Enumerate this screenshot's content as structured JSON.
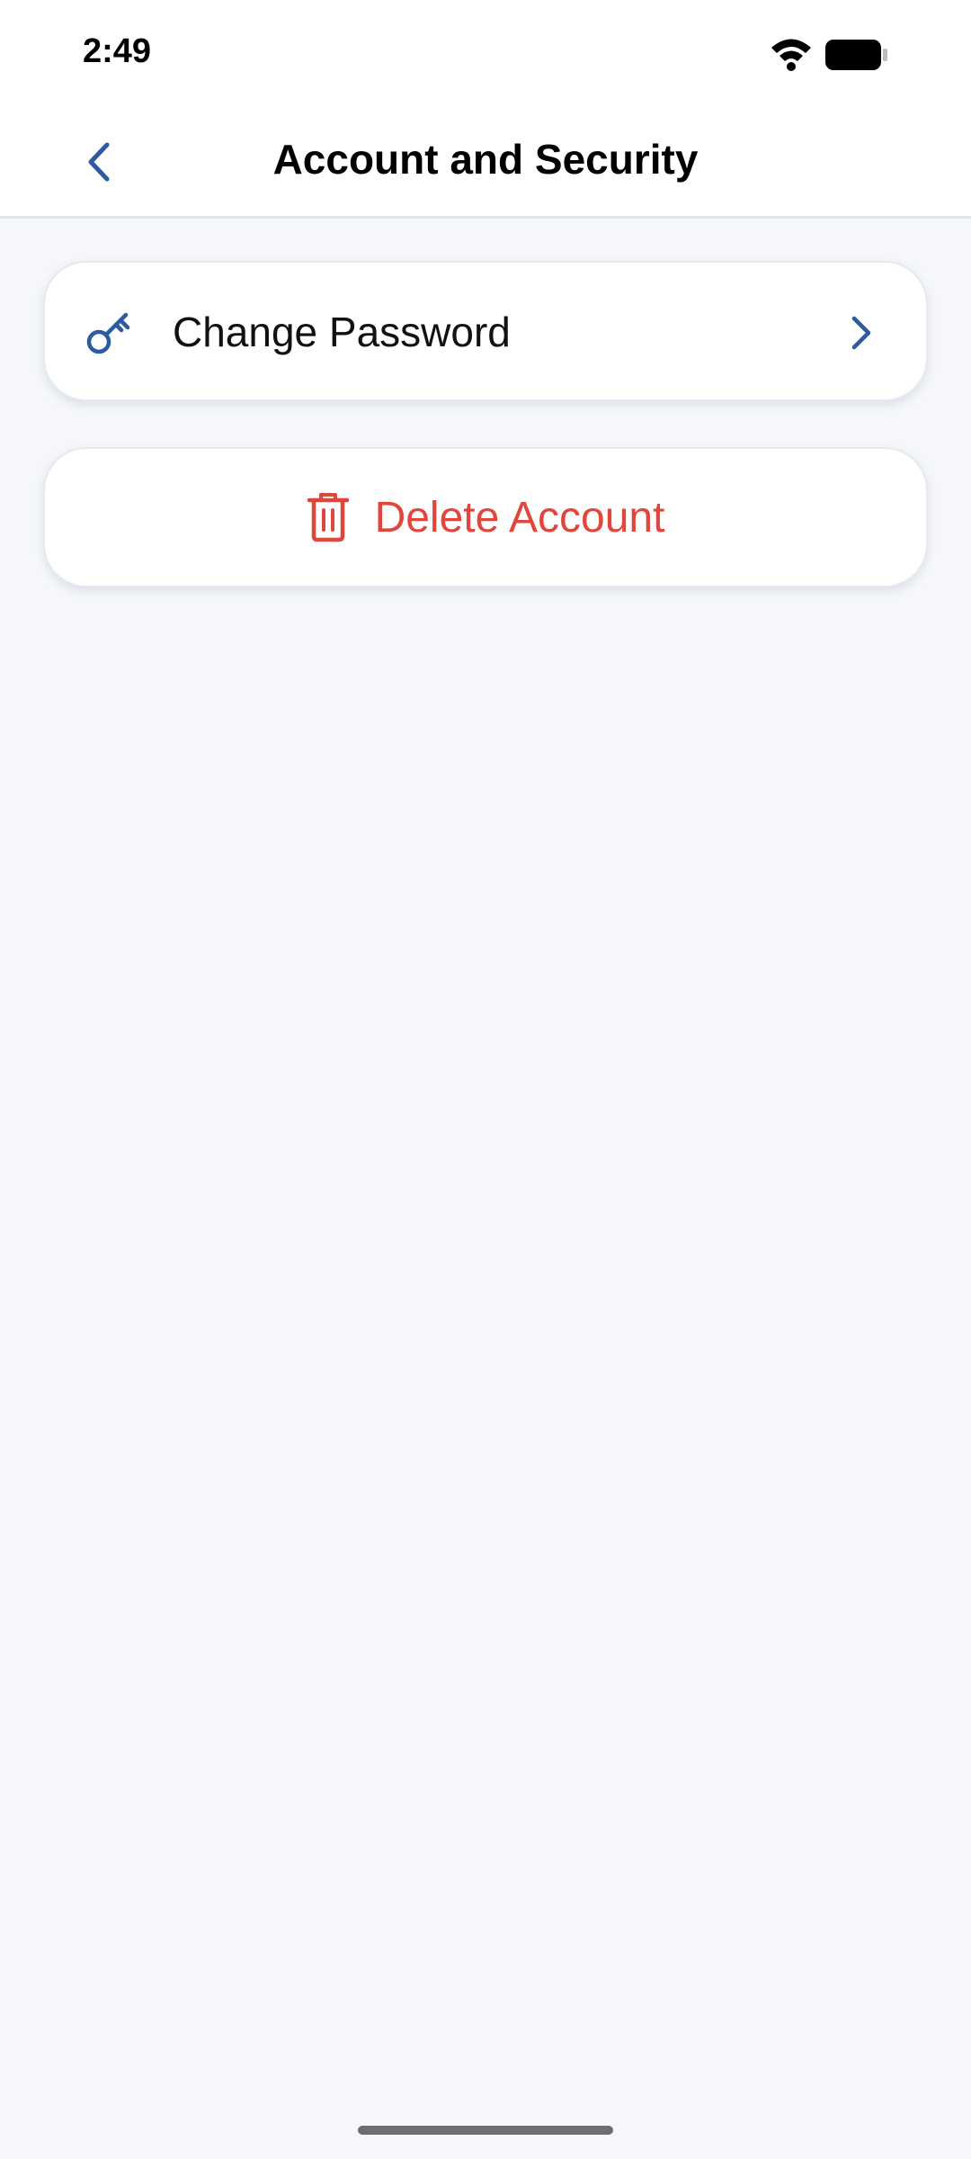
{
  "status_bar": {
    "time": "2:49"
  },
  "header": {
    "title": "Account and Security",
    "back_icon": "chevron-left-icon"
  },
  "menu": {
    "change_password": {
      "label": "Change Password",
      "icon": "key-icon",
      "trailing_icon": "chevron-right-icon"
    },
    "delete_account": {
      "label": "Delete Account",
      "icon": "trash-icon"
    }
  },
  "colors": {
    "accent": "#2d5aa0",
    "danger": "#e0463b",
    "background": "#f5f7fa",
    "card": "#ffffff"
  }
}
